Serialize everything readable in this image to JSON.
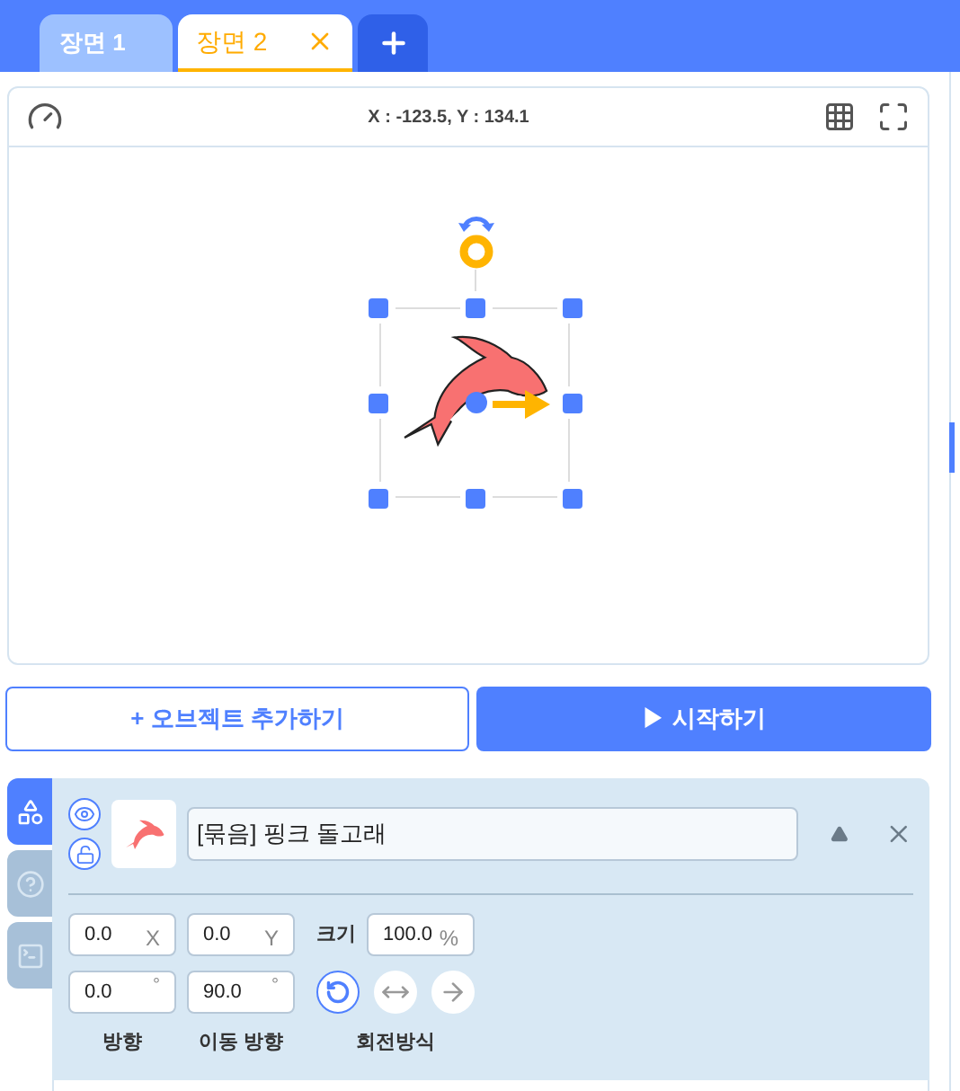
{
  "scene_tabs": [
    {
      "label": "장면 1",
      "selected": false
    },
    {
      "label": "장면 2",
      "selected": true
    }
  ],
  "stage": {
    "coordinates": "X : -123.5, Y : 134.1"
  },
  "buttons": [
    {
      "kind": "outline",
      "label": "+ 오브젝트 추가하기"
    },
    {
      "kind": "primary",
      "label": "▶ 시작하기"
    }
  ],
  "side_tabs": [
    {
      "kind": "objects",
      "selected": true
    },
    {
      "kind": "help",
      "selected": false
    },
    {
      "kind": "console",
      "selected": false
    }
  ],
  "object": {
    "name": "[묶음] 핑크 돌고래",
    "visible": true,
    "locked": false,
    "fields": [
      {
        "value": "0.0",
        "unit": "X"
      },
      {
        "value": "0.0",
        "unit": "Y"
      }
    ],
    "size": {
      "label": "크기",
      "value": "100.0",
      "unit": "%"
    },
    "direction_fields": [
      {
        "value": "0.0",
        "unit": "°",
        "label": "방향"
      },
      {
        "value": "90.0",
        "unit": "°",
        "label": "이동 방향"
      }
    ],
    "rotation": {
      "label": "회전방식",
      "modes": [
        {
          "kind": "free",
          "selected": true
        },
        {
          "kind": "horizontal",
          "selected": false
        },
        {
          "kind": "none",
          "selected": false
        }
      ]
    }
  }
}
